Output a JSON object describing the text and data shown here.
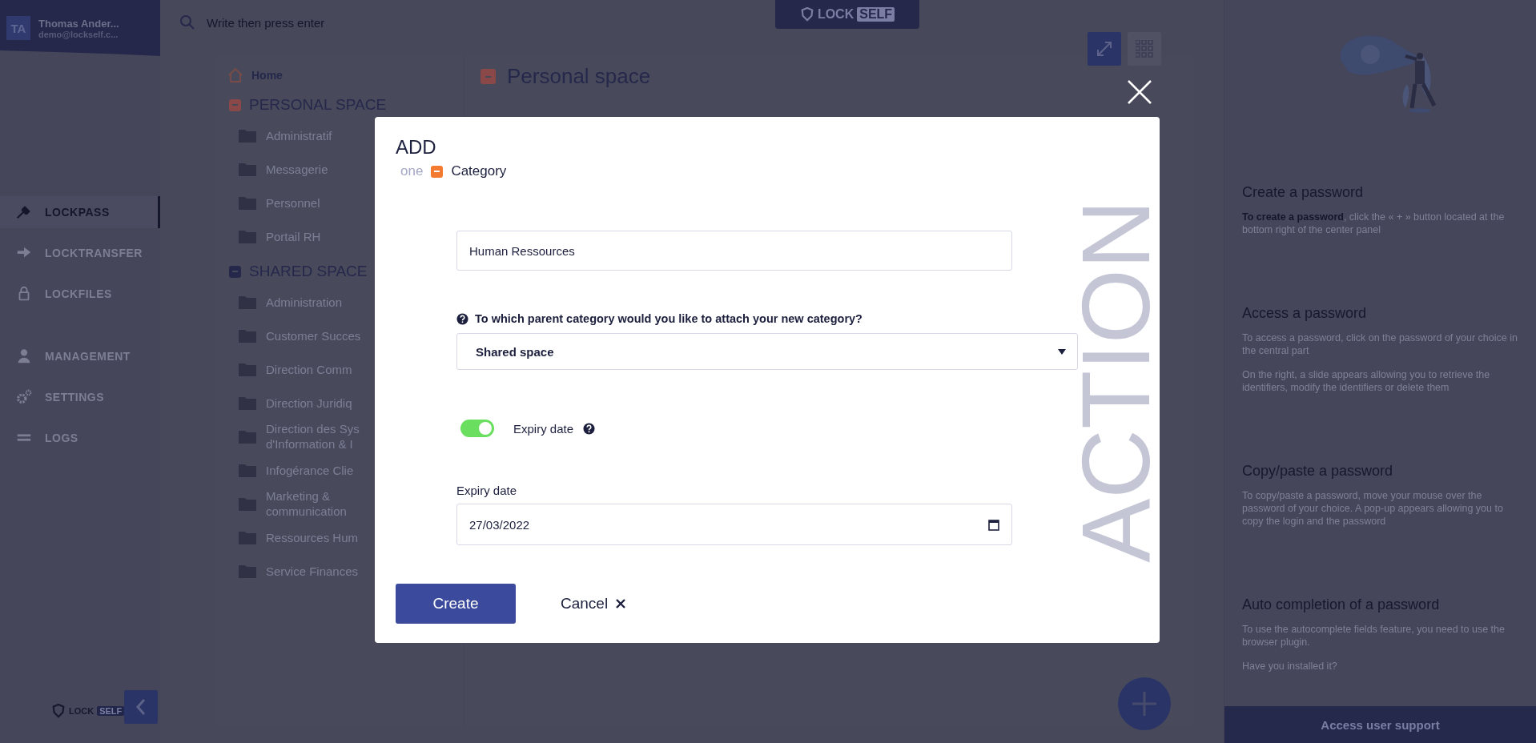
{
  "user": {
    "initials": "TA",
    "name": "Thomas Ander...",
    "email": "demo@lockself.c..."
  },
  "nav_groups": [
    [
      {
        "label": "LOCKPASS",
        "selected": true
      },
      {
        "label": "LOCKTRANSFER",
        "selected": false
      },
      {
        "label": "LOCKFILES",
        "selected": false
      }
    ],
    [
      {
        "label": "MANAGEMENT",
        "selected": false
      },
      {
        "label": "SETTINGS",
        "selected": false
      },
      {
        "label": "LOGS",
        "selected": false
      }
    ]
  ],
  "logo_top": {
    "word": "LOCK",
    "badge": "SELF"
  },
  "logo_bottom": {
    "word": "LOCK",
    "badge": "SELF"
  },
  "search": {
    "placeholder": "Write then press enter"
  },
  "categories": {
    "home": "Home",
    "sections": [
      {
        "title": "PERSONAL SPACE",
        "color": "#8a4848",
        "items": [
          "Administratif",
          "Messagerie",
          "Personnel",
          "Portail RH"
        ]
      },
      {
        "title": "SHARED SPACE",
        "color": "#25284a",
        "items": [
          "Administration",
          "Customer Succes",
          "Direction Comm",
          "Direction Juridiq",
          "Direction des Sys\nd'Information & I",
          "Infogérance Clie",
          "Marketing &\ncommunication",
          "Ressources Hum",
          "Service Finances"
        ]
      }
    ]
  },
  "main": {
    "title": "Personal space"
  },
  "help": {
    "sections": [
      {
        "title": "Create a password",
        "paragraphs": [
          "**To create a password**, click the « + » button located at the bottom right of the center panel"
        ]
      },
      {
        "title": "Access a password",
        "paragraphs": [
          "To access a password, click on the password of your choice in the central part",
          "On the right, a slide appears allowing you to retrieve the identifiers, modify the identifiers or delete them"
        ]
      },
      {
        "title": "Copy/paste a password",
        "paragraphs": [
          "To copy/paste a password, move your mouse over the password of your choice. A pop-up appears allowing you to copy the login and the password"
        ]
      },
      {
        "title": "Auto completion of a password",
        "paragraphs": [
          "To use the autocomplete fields feature, you need to use the browser plugin.",
          "Have you installed it?"
        ]
      }
    ],
    "support_button": "Access user support"
  },
  "modal": {
    "title": "ADD",
    "step": "one",
    "subtitle": "Category",
    "name_value": "Human Ressources",
    "question": "To which parent category would you like to attach your new category?",
    "parent_select": "Shared space",
    "toggle": {
      "label": "Expiry date",
      "on": true
    },
    "date_label": "Expiry date",
    "date_value": "27/03/2022",
    "create": "Create",
    "cancel": "Cancel",
    "side_text": "ACTION"
  }
}
